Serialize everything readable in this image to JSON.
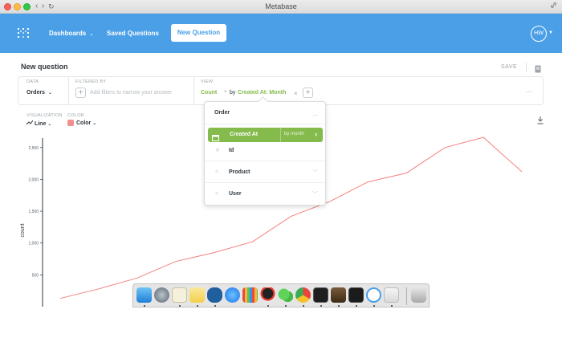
{
  "window": {
    "title": "Metabase",
    "back_glyph": "‹",
    "forward_glyph": "›",
    "reload_glyph": "↻",
    "link_glyph": "🔗"
  },
  "nav": {
    "dashboards": "Dashboards",
    "saved_questions": "Saved Questions",
    "new_question": "New Question",
    "avatar_initials": "HW",
    "brand_color": "#4a9fe7"
  },
  "header": {
    "title": "New question",
    "save": "SAVE"
  },
  "query": {
    "data_label": "DATA",
    "data_value": "Orders",
    "filter_label": "FILTERED BY",
    "filter_placeholder": "Add filters to narrow your answer",
    "view_label": "VIEW",
    "view_metric": "Count",
    "view_by": "by",
    "view_breakout": "Created At: Month",
    "dots": "• • •"
  },
  "controls": {
    "viz_label": "VISUALIZATION",
    "viz_value": "Line",
    "color_label": "COLOR",
    "color_value": "Color",
    "color_swatch": "#f28e8e"
  },
  "popover": {
    "title": "Order",
    "selected_field": "Created At",
    "selected_granularity": "by month",
    "rows": [
      {
        "icon": "#",
        "label": "Id"
      },
      {
        "icon": "<",
        "label": "Product"
      },
      {
        "icon": "<",
        "label": "User"
      }
    ],
    "accent": "#84bb4c"
  },
  "chart_data": {
    "type": "line",
    "ylabel": "count",
    "y_ticks": [
      "2,500",
      "2,000",
      "1,500",
      "1,000",
      "500"
    ],
    "ylim": [
      0,
      2800
    ],
    "series": [
      {
        "color": "#f47f7f",
        "values": [
          130,
          280,
          450,
          710,
          850,
          1020,
          1420,
          1650,
          1960,
          2100,
          2500,
          2660,
          2120
        ]
      }
    ]
  }
}
